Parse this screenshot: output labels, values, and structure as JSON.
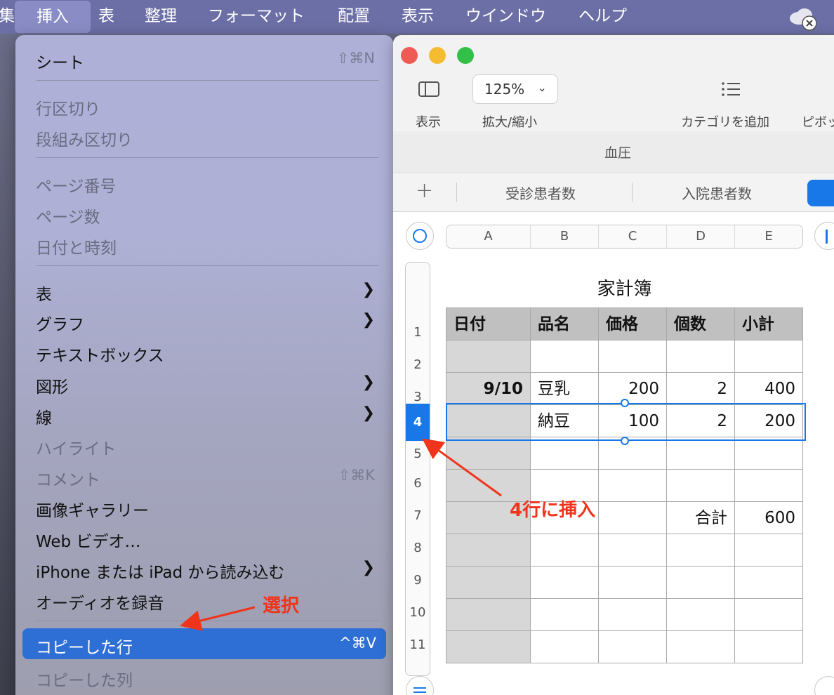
{
  "menubar": {
    "items": [
      "集",
      "挿入",
      "表",
      "整理",
      "フォーマット",
      "配置",
      "表示",
      "ウインドウ",
      "ヘルプ"
    ]
  },
  "insert_menu": {
    "items": [
      {
        "label": "シート",
        "shortcut": "⇧⌘N",
        "enabled": true
      },
      {
        "label": "行区切り",
        "enabled": false
      },
      {
        "label": "段組み区切り",
        "enabled": false
      },
      {
        "label": "ページ番号",
        "enabled": false
      },
      {
        "label": "ページ数",
        "enabled": false
      },
      {
        "label": "日付と時刻",
        "enabled": false
      },
      {
        "label": "表",
        "submenu": true,
        "enabled": true
      },
      {
        "label": "グラフ",
        "submenu": true,
        "enabled": true
      },
      {
        "label": "テキストボックス",
        "enabled": true
      },
      {
        "label": "図形",
        "submenu": true,
        "enabled": true
      },
      {
        "label": "線",
        "submenu": true,
        "enabled": true
      },
      {
        "label": "ハイライト",
        "enabled": false
      },
      {
        "label": "コメント",
        "shortcut": "⇧⌘K",
        "enabled": false
      },
      {
        "label": "画像ギャラリー",
        "enabled": true
      },
      {
        "label": "Web ビデオ…",
        "enabled": true
      },
      {
        "label": "iPhone または iPad から読み込む",
        "submenu": true,
        "enabled": true
      },
      {
        "label": "オーディオを録音",
        "enabled": true
      },
      {
        "label": "コピーした行",
        "shortcut": "^⌘V",
        "enabled": true,
        "highlighted": true
      },
      {
        "label": "コピーした列",
        "enabled": false
      }
    ]
  },
  "window": {
    "toolbar": {
      "view_label": "表示",
      "zoom_value": "125%",
      "zoom_label": "拡大/縮小",
      "category_label": "カテゴリを追加",
      "pivot_label": "ピボッ"
    },
    "document_title": "血圧",
    "sheet_tabs": [
      "受診患者数",
      "入院患者数"
    ]
  },
  "spreadsheet": {
    "column_headers": [
      "A",
      "B",
      "C",
      "D",
      "E"
    ],
    "row_headers": [
      "1",
      "2",
      "3",
      "4",
      "5",
      "6",
      "7",
      "8",
      "9",
      "10",
      "11"
    ],
    "selected_row": "4",
    "table_title": "家計簿",
    "header_row": [
      "日付",
      "品名",
      "価格",
      "個数",
      "小計"
    ],
    "rows": [
      [
        "",
        "",
        "",
        "",
        ""
      ],
      [
        "9/10",
        "豆乳",
        "200",
        "2",
        "400"
      ],
      [
        "",
        "納豆",
        "100",
        "2",
        "200"
      ],
      [
        "",
        "",
        "",
        "",
        ""
      ],
      [
        "",
        "",
        "",
        "",
        ""
      ],
      [
        "",
        "",
        "",
        "合計",
        "600"
      ],
      [
        "",
        "",
        "",
        "",
        ""
      ],
      [
        "",
        "",
        "",
        "",
        ""
      ],
      [
        "",
        "",
        "",
        "",
        ""
      ],
      [
        "",
        "",
        "",
        "",
        ""
      ]
    ]
  },
  "annotations": {
    "select_label": "選択",
    "insert_label": "4行に挿入",
    "color": "#f0341b"
  },
  "colors": {
    "accent": "#1878e8",
    "menu_highlight": "#2e6fd6"
  }
}
